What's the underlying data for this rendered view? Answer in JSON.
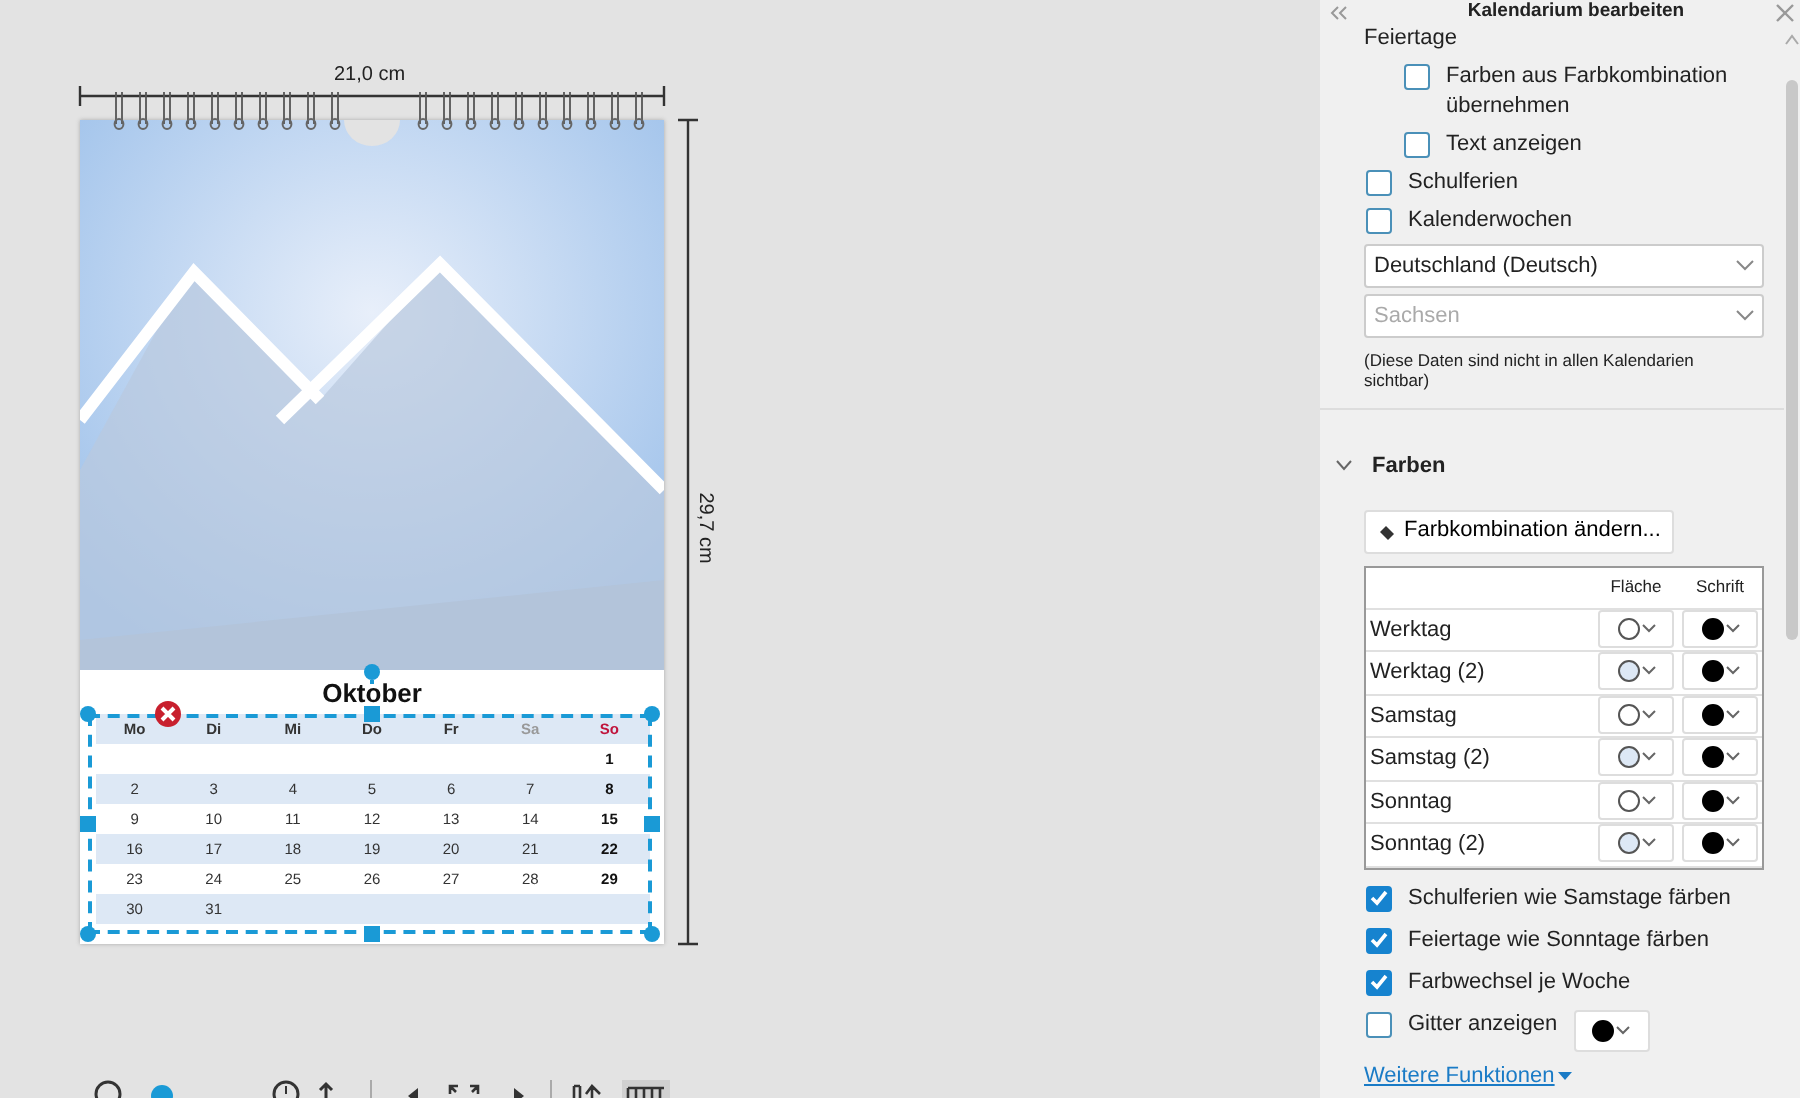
{
  "canvas": {
    "width_label": "21,0 cm",
    "height_label": "29,7 cm",
    "calendar": {
      "month": "Oktober",
      "weekdays": [
        {
          "label": "Mo",
          "kind": "weekday"
        },
        {
          "label": "Di",
          "kind": "weekday"
        },
        {
          "label": "Mi",
          "kind": "weekday"
        },
        {
          "label": "Do",
          "kind": "weekday"
        },
        {
          "label": "Fr",
          "kind": "weekday"
        },
        {
          "label": "Sa",
          "kind": "saturday"
        },
        {
          "label": "So",
          "kind": "sunday"
        }
      ],
      "weeks": [
        {
          "shaded": false,
          "right_aligned": true,
          "days": [
            "1"
          ]
        },
        {
          "shaded": true,
          "days": [
            "2",
            "3",
            "4",
            "5",
            "6",
            "7",
            "8"
          ]
        },
        {
          "shaded": false,
          "days": [
            "9",
            "10",
            "11",
            "12",
            "13",
            "14",
            "15"
          ]
        },
        {
          "shaded": true,
          "days": [
            "16",
            "17",
            "18",
            "19",
            "20",
            "21",
            "22"
          ]
        },
        {
          "shaded": false,
          "days": [
            "23",
            "24",
            "25",
            "26",
            "27",
            "28",
            "29"
          ]
        },
        {
          "shaded": true,
          "right_aligned": false,
          "days": [
            "30",
            "31"
          ]
        }
      ]
    }
  },
  "panel": {
    "title": "Kalendarium bearbeiten",
    "holidays": {
      "label": "Feiertage",
      "children": [
        {
          "label": "Farben aus Farbkombination übernehmen",
          "checked": false
        },
        {
          "label": "Text anzeigen",
          "checked": false
        }
      ]
    },
    "options": [
      {
        "label": "Schulferien",
        "checked": false
      },
      {
        "label": "Kalenderwochen",
        "checked": false
      }
    ],
    "country": {
      "value": "Deutschland (Deutsch)",
      "disabled": false
    },
    "region": {
      "placeholder": "Sachsen",
      "disabled": true
    },
    "note": "(Diese Daten sind nicht in allen Kalendarien sichtbar)",
    "colors_section": {
      "title": "Farben",
      "expanded": true,
      "button": "Farbkombination ändern...",
      "columns": [
        "Fläche",
        "Schrift"
      ],
      "rows": [
        {
          "label": "Werktag",
          "fill_tinted": false
        },
        {
          "label": "Werktag (2)",
          "fill_tinted": true
        },
        {
          "label": "Samstag",
          "fill_tinted": false
        },
        {
          "label": "Samstag (2)",
          "fill_tinted": true
        },
        {
          "label": "Sonntag",
          "fill_tinted": false
        },
        {
          "label": "Sonntag (2)",
          "fill_tinted": true
        }
      ],
      "checkboxes": [
        {
          "label": "Schulferien wie Samstage färben",
          "checked": true
        },
        {
          "label": "Feiertage wie Sonntage färben",
          "checked": true
        },
        {
          "label": "Farbwechsel je Woche",
          "checked": true
        },
        {
          "label": "Gitter anzeigen",
          "checked": false,
          "kind": "with_color"
        }
      ]
    },
    "more_link": "Weitere Funktionen"
  }
}
